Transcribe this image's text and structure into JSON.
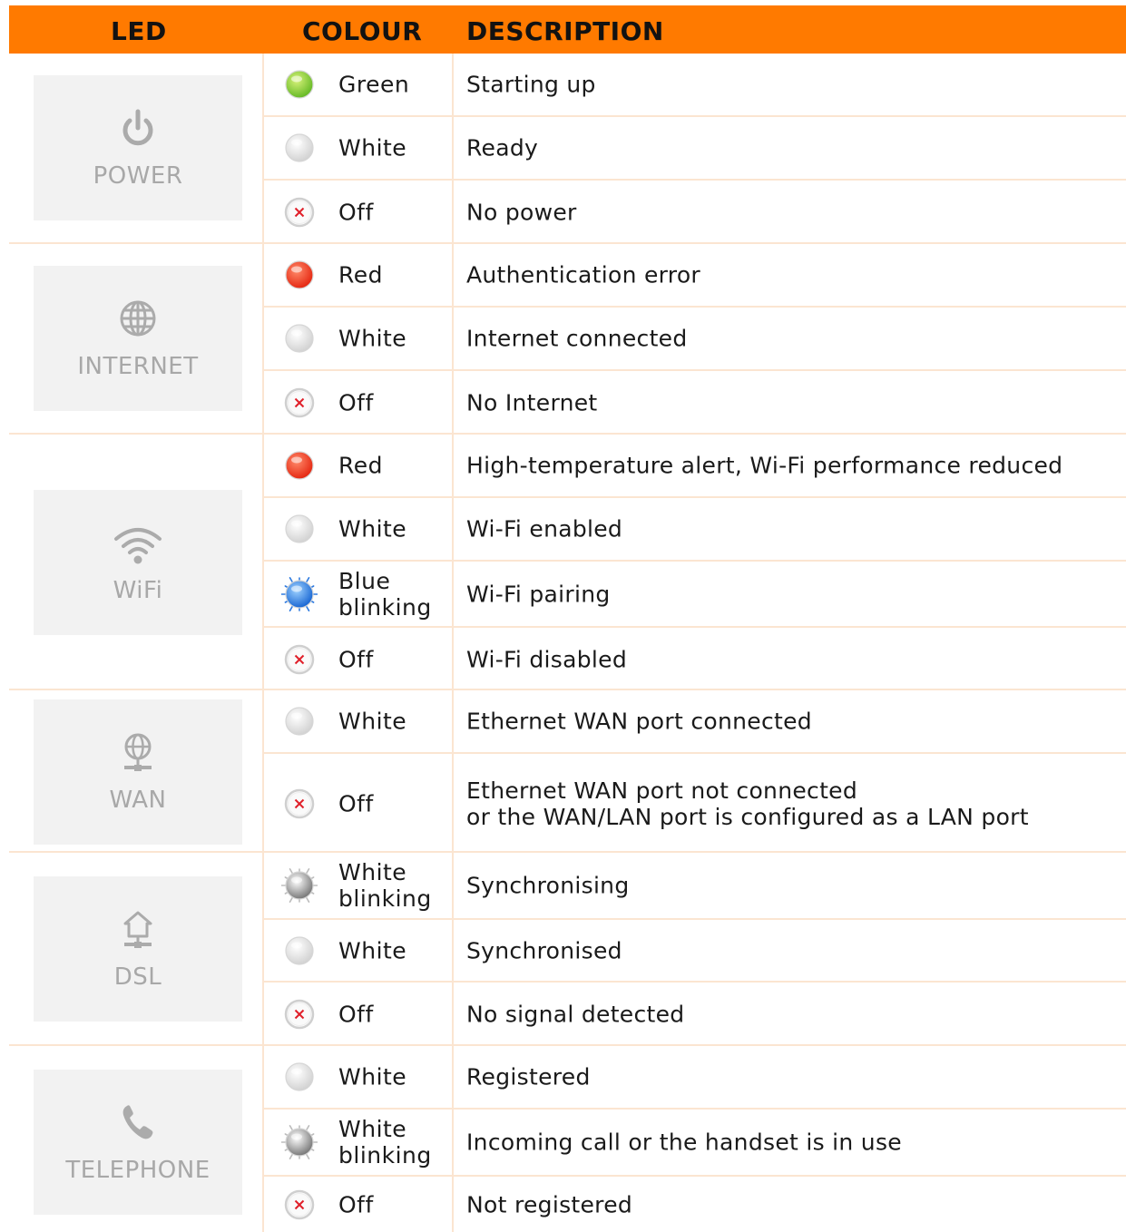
{
  "header": {
    "led": "LED",
    "colour": "COLOUR",
    "description": "DESCRIPTION"
  },
  "colors": {
    "header_bg": "#ff7a00",
    "divider": "#fbe5d1",
    "card_bg": "#f2f2f2",
    "card_text": "#a8a8a8"
  },
  "groups": [
    {
      "label": "POWER",
      "icon": "power-icon",
      "rows": [
        {
          "colour": "Green",
          "led": "green",
          "description": "Starting up"
        },
        {
          "colour": "White",
          "led": "white",
          "description": "Ready"
        },
        {
          "colour": "Off",
          "led": "off",
          "description": "No power"
        }
      ]
    },
    {
      "label": "INTERNET",
      "icon": "globe-icon",
      "rows": [
        {
          "colour": "Red",
          "led": "red",
          "description": "Authentication error"
        },
        {
          "colour": "White",
          "led": "white",
          "description": "Internet connected"
        },
        {
          "colour": "Off",
          "led": "off",
          "description": "No Internet"
        }
      ]
    },
    {
      "label": "WiFi",
      "icon": "wifi-icon",
      "rows": [
        {
          "colour": "Red",
          "led": "red",
          "description": "High-temperature alert, Wi-Fi performance reduced"
        },
        {
          "colour": "White",
          "led": "white",
          "description": "Wi-Fi enabled"
        },
        {
          "colour": "Blue\nblinking",
          "led": "blue-blinking",
          "description": "Wi-Fi pairing"
        },
        {
          "colour": "Off",
          "led": "off",
          "description": "Wi-Fi disabled"
        }
      ]
    },
    {
      "label": "WAN",
      "icon": "wan-icon",
      "rows": [
        {
          "colour": "White",
          "led": "white",
          "description": "Ethernet WAN port connected"
        },
        {
          "colour": "Off",
          "led": "off",
          "description": "Ethernet WAN port not connected\nor the WAN/LAN port is configured as a LAN port"
        }
      ]
    },
    {
      "label": "DSL",
      "icon": "dsl-icon",
      "rows": [
        {
          "colour": "White\nblinking",
          "led": "white-blinking",
          "description": "Synchronising"
        },
        {
          "colour": "White",
          "led": "white",
          "description": "Synchronised"
        },
        {
          "colour": "Off",
          "led": "off",
          "description": "No signal detected"
        }
      ]
    },
    {
      "label": "TELEPHONE",
      "icon": "phone-icon",
      "rows": [
        {
          "colour": "White",
          "led": "white",
          "description": "Registered"
        },
        {
          "colour": "White\nblinking",
          "led": "white-blinking",
          "description": "Incoming call or the handset is in use"
        },
        {
          "colour": "Off",
          "led": "off",
          "description": "Not registered"
        }
      ]
    }
  ]
}
